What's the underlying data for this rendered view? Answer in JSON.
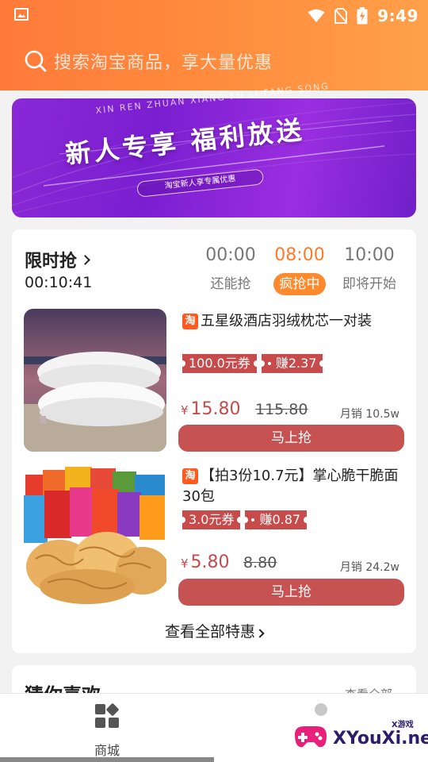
{
  "status_bar": {
    "time": "9:49",
    "icons": [
      "image-icon",
      "wifi-icon",
      "no-sim-icon",
      "battery-charging-icon"
    ]
  },
  "search": {
    "placeholder": "搜索淘宝商品，享大量优惠",
    "icon": "search-icon"
  },
  "banner": {
    "subtitle": "XIN REN ZHUAN XIANG FU LI FANG SONG",
    "title": "新人专享 福利放送",
    "pill": "淘宝新人享专属优惠"
  },
  "flash_sale": {
    "title": "限时抢",
    "countdown": "00:10:41",
    "slots": [
      {
        "time": "00:00",
        "status": "还能抢",
        "active": false
      },
      {
        "time": "08:00",
        "status": "疯抢中",
        "active": true
      },
      {
        "time": "10:00",
        "status": "即将开始",
        "active": false
      }
    ],
    "items": [
      {
        "badge": "淘",
        "title": "五星级酒店羽绒枕芯一对装",
        "coupon": "100.0元券",
        "earn": "赚2.37",
        "currency": "¥",
        "price": "15.80",
        "original_price": "115.80",
        "sold": "月销 10.5w",
        "button": "马上抢"
      },
      {
        "badge": "淘",
        "title": "【拍3份10.7元】掌心脆干脆面30包",
        "coupon": "3.0元券",
        "earn": "赚0.87",
        "currency": "¥",
        "price": "5.80",
        "original_price": "8.80",
        "sold": "月销 24.2w",
        "button": "马上抢"
      }
    ],
    "view_all": "查看全部特惠"
  },
  "guess": {
    "title": "猜你喜欢",
    "more": "查看全部"
  },
  "tabbar": {
    "home_label": "商城"
  },
  "watermark": {
    "text": "XYouXi.net",
    "small": "X游戏"
  },
  "colors": {
    "header_orange": "#ff8a3d",
    "accent_orange": "#ff7a2a",
    "price_red": "#c74b4b",
    "banner_purple": "#8a28d6"
  }
}
